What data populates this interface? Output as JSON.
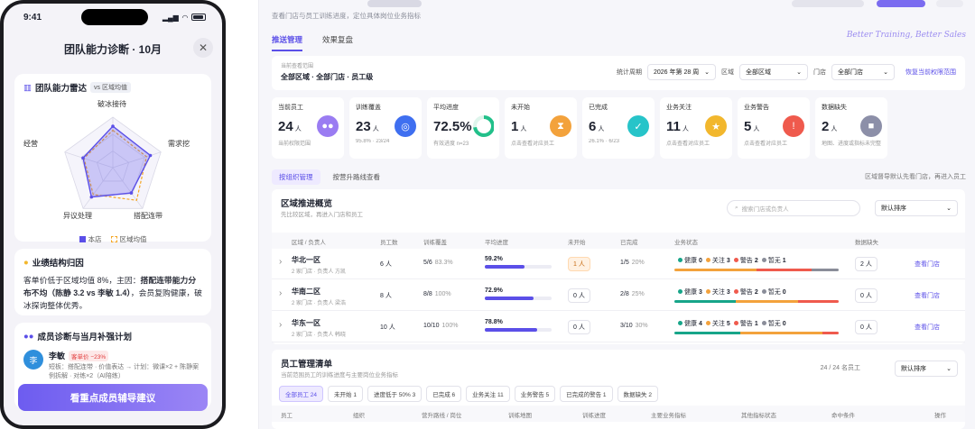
{
  "phone": {
    "time": "9:41",
    "sheet_title": "团队能力诊断 · 10月",
    "radar": {
      "title": "团队能力雷达",
      "vs_tag": "vs 区域均值",
      "axes": [
        "破冰接待",
        "需求挖",
        "搭配连带",
        "异议处理",
        "经营"
      ],
      "legend_store": "本店",
      "legend_region": "区域均值",
      "store_color": "#5b4fe8",
      "region_color": "#f5a623"
    },
    "chart_data": {
      "type": "radar",
      "categories": [
        "破冰接待",
        "需求挖",
        "搭配连带",
        "异议处理",
        "经营"
      ],
      "series": [
        {
          "name": "本店",
          "values": [
            0.82,
            0.78,
            0.62,
            0.72,
            0.62
          ]
        },
        {
          "name": "区域均值",
          "values": [
            0.74,
            0.7,
            0.8,
            0.66,
            0.6
          ]
        }
      ]
    },
    "structure": {
      "title": "业绩结构归因",
      "text_a": "客单价低于区域均值 8%，主因：",
      "text_b": "搭配连带能力分布不均（陈静 3.2 vs 李敏 1.4）",
      "text_c": "，会员复购健康，破冰探询整体优秀。"
    },
    "plan": {
      "title": "成员诊断与当月补强计划",
      "member_avatar": "李",
      "member_name": "李敏",
      "member_badge": "客单价 −23%",
      "member_detail_1": "短板：搭配连带 · 价值表达 → 计划：微课×2 + 陈静案",
      "member_detail_2": "例拆解 · 对练×2（AI陪练）"
    },
    "cta": "看重点成员辅导建议"
  },
  "desk": {
    "subtitle": "查看门店与员工训练进度，定位具体岗位业务指标",
    "tabs": [
      "推送管理",
      "效果复盘"
    ],
    "slogan": "Better Training, Better Sales",
    "filter": {
      "scope_label": "当前查看范围",
      "scope_value": "全部区域 · 全部门店 · 员工级",
      "period_label": "统计周期",
      "period_value": "2026 年第 28 周",
      "region_label": "区域",
      "region_value": "全部区域",
      "store_label": "门店",
      "store_value": "全部门店",
      "restore_link": "恢复当前权限范围"
    },
    "kpis": [
      {
        "title": "当前员工",
        "value": "24",
        "unit": "人",
        "sub": "当前权限范围",
        "icon": "team-icon",
        "color": "#9a7cf2",
        "glyph": "●●"
      },
      {
        "title": "训练覆盖",
        "value": "23",
        "unit": "人",
        "sub": "95.8% · 23/24",
        "icon": "target-icon",
        "color": "#3f6ff0",
        "glyph": "◎"
      },
      {
        "title": "平均进度",
        "value": "72.5%",
        "unit": "",
        "sub": "有效进度 n=23",
        "icon": "progress-ring-icon",
        "color": "#22c08a",
        "glyph": ""
      },
      {
        "title": "未开始",
        "value": "1",
        "unit": "人",
        "sub": "点击查看对应员工",
        "icon": "hourglass-icon",
        "color": "#f3a23c",
        "glyph": "⧗"
      },
      {
        "title": "已完成",
        "value": "6",
        "unit": "人",
        "sub": "26.1% · 6/23",
        "icon": "check-icon",
        "color": "#27c4c9",
        "glyph": "✓"
      },
      {
        "title": "业务关注",
        "value": "11",
        "unit": "人",
        "sub": "点击查看对应员工",
        "icon": "star-icon",
        "color": "#f2b72d",
        "glyph": "★"
      },
      {
        "title": "业务警告",
        "value": "5",
        "unit": "人",
        "sub": "点击查看对应员工",
        "icon": "alarm-icon",
        "color": "#ef5a4d",
        "glyph": "!"
      },
      {
        "title": "数据缺失",
        "value": "2",
        "unit": "人",
        "sub": "地图、进度或指标未完整",
        "icon": "cube-icon",
        "color": "#8c8fa8",
        "glyph": "■"
      }
    ],
    "avg_progress": 72.5,
    "segments": [
      "按组织管理",
      "按营升路线查看"
    ],
    "seg_note": "区域督导默认先看门店，再进入员工",
    "region": {
      "title": "区域推进概览",
      "subtitle": "先比较区域，再进入门店和员工",
      "search_placeholder": "搜索门店或负责人",
      "sort_value": "默认排序",
      "headers": [
        "区域 / 负责人",
        "员工数",
        "训练覆盖",
        "平均进度",
        "未开始",
        "已完成",
        "业务状态",
        "数据缺失"
      ],
      "status_labels": {
        "health": "健康",
        "attention": "关注",
        "warn": "警告",
        "none": "暂无"
      },
      "status_colors": {
        "health": "#17a589",
        "attention": "#f3a23c",
        "warn": "#ef5a4d",
        "none": "#8a8d99"
      },
      "rows": [
        {
          "name": "华北一区",
          "manager": "2 家门店 · 负责人 方凯",
          "staff": "6 人",
          "cov": "5/6",
          "cov_pct": "83.3%",
          "progress": "59.2%",
          "progress_val": 59.2,
          "not_started": "1 人",
          "ns_warn": true,
          "done": "1/5",
          "done_pct": "20%",
          "health": 0,
          "attention": 3,
          "warn": 2,
          "none": 1,
          "missing": "2 人",
          "action": "查看门店"
        },
        {
          "name": "华南二区",
          "manager": "2 家门店 · 负责人 梁浩",
          "staff": "8 人",
          "cov": "8/8",
          "cov_pct": "100%",
          "progress": "72.9%",
          "progress_val": 72.9,
          "not_started": "0 人",
          "ns_warn": false,
          "done": "2/8",
          "done_pct": "25%",
          "health": 3,
          "attention": 3,
          "warn": 2,
          "none": 0,
          "missing": "0 人",
          "action": "查看门店"
        },
        {
          "name": "华东一区",
          "manager": "2 家门店 · 负责人 韩晓",
          "staff": "10 人",
          "cov": "10/10",
          "cov_pct": "100%",
          "progress": "78.8%",
          "progress_val": 78.8,
          "not_started": "0 人",
          "ns_warn": false,
          "done": "3/10",
          "done_pct": "30%",
          "health": 4,
          "attention": 5,
          "warn": 1,
          "none": 0,
          "missing": "0 人",
          "action": "查看门店"
        }
      ]
    },
    "staff": {
      "title": "员工管理清单",
      "subtitle": "当前范围员工的训练进度与主要岗位业务指标",
      "count": "24 / 24 名员工",
      "sort_value": "默认排序",
      "chips": [
        "全部员工 24",
        "未开始 1",
        "进度低于 50% 3",
        "已完成 6",
        "业务关注 11",
        "业务警告 5",
        "已完成的警告 1",
        "数据缺失 2"
      ],
      "headers": [
        "员工",
        "组织",
        "营升路线 / 岗位",
        "训练地图",
        "训练进度",
        "主要业务指标",
        "其他指标状态",
        "命中条件",
        "操作"
      ]
    }
  }
}
